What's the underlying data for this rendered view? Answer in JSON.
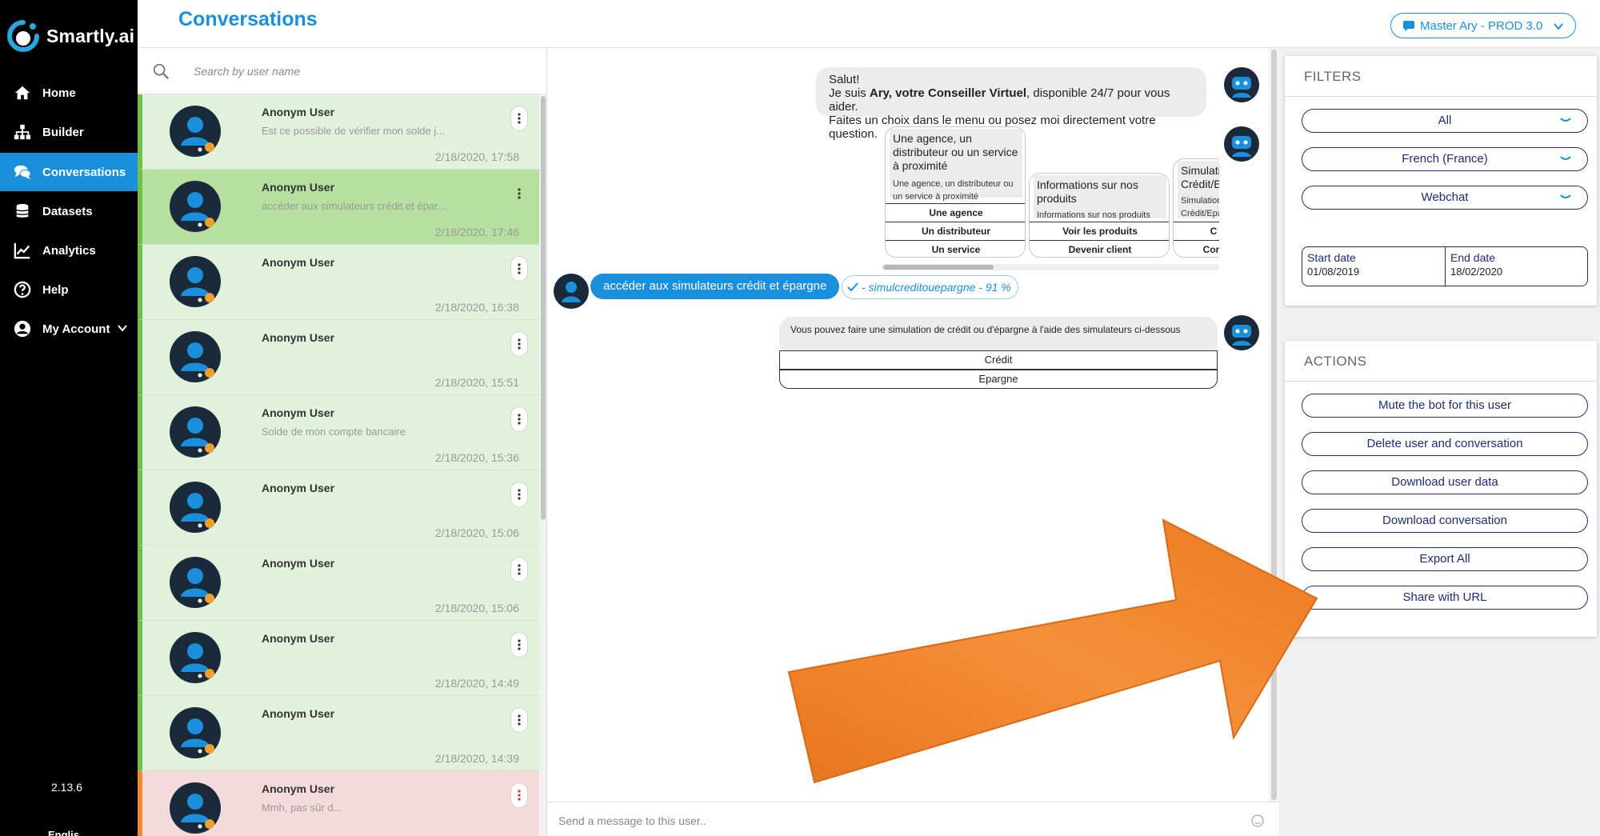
{
  "brand": {
    "name": "Smartly.ai"
  },
  "sidebar": {
    "items": [
      {
        "label": "Home",
        "icon": "home-icon"
      },
      {
        "label": "Builder",
        "icon": "sitemap-icon"
      },
      {
        "label": "Conversations",
        "icon": "chat-icon"
      },
      {
        "label": "Datasets",
        "icon": "database-icon"
      },
      {
        "label": "Analytics",
        "icon": "chart-icon"
      },
      {
        "label": "Help",
        "icon": "help-icon"
      },
      {
        "label": "My Account",
        "icon": "user-icon"
      }
    ],
    "version": "2.13.6"
  },
  "header": {
    "title": "Conversations",
    "bot_selector": "Master Ary - PROD 3.0"
  },
  "search": {
    "placeholder": "Search by user name"
  },
  "conversations": [
    {
      "name": "Anonym User",
      "preview": "Est ce possible de vérifier mon solde j...",
      "time": "2/18/2020, 17:58"
    },
    {
      "name": "Anonym User",
      "preview": "accéder aux simulateurs crédit et épar...",
      "time": "2/18/2020, 17:46"
    },
    {
      "name": "Anonym User",
      "preview": "",
      "time": "2/18/2020, 16:38"
    },
    {
      "name": "Anonym User",
      "preview": "",
      "time": "2/18/2020, 15:51"
    },
    {
      "name": "Anonym User",
      "preview": "Solde de mon compte bancaire",
      "time": "2/18/2020, 15:36"
    },
    {
      "name": "Anonym User",
      "preview": "",
      "time": "2/18/2020, 15:06"
    },
    {
      "name": "Anonym User",
      "preview": "",
      "time": "2/18/2020, 15:06"
    },
    {
      "name": "Anonym User",
      "preview": "",
      "time": "2/18/2020, 14:49"
    },
    {
      "name": "Anonym User",
      "preview": "",
      "time": "2/18/2020, 14:39"
    },
    {
      "name": "Anonym User",
      "preview": "Mmh, pas sûr d...",
      "time": ""
    }
  ],
  "chat": {
    "welcome": {
      "line1": "Salut!",
      "line2_pre": "Je suis ",
      "line2_bold": "Ary, votre Conseiller Virtuel",
      "line2_post": ", disponible 24/7 pour vous aider.",
      "line3": "Faites un choix dans le menu ou posez moi directement votre question."
    },
    "cards": [
      {
        "title": "Une agence, un distributeur ou un service à proximité",
        "subtitle": "Une agence, un distributeur ou un service à proximité",
        "buttons": [
          "Une agence",
          "Un distributeur",
          "Un service"
        ]
      },
      {
        "title": "Informations sur nos produits",
        "subtitle": "Informations sur nos produits",
        "buttons": [
          "Voir les produits",
          "Devenir client"
        ]
      },
      {
        "title": "Simulati Crédit/E",
        "subtitle": "Simulation Crédit/Epa",
        "buttons": [
          "C",
          "Com"
        ]
      }
    ],
    "user_message": "accéder aux simulateurs crédit et épargne",
    "intent": "- simulcreditouepargne - 91 %",
    "bot_reply": "Vous pouvez faire une simulation de crédit ou d'épargne à l'aide des simulateurs ci-dessous",
    "reply_buttons": [
      "Crédit",
      "Epargne"
    ],
    "composer_placeholder": "Send a message to this user.."
  },
  "filters": {
    "title": "FILTERS",
    "selects": [
      "All",
      "French (France)",
      "Webchat"
    ],
    "start_label": "Start date",
    "start_value": "01/08/2019",
    "end_label": "End date",
    "end_value": "18/02/2020"
  },
  "actions": {
    "title": "ACTIONS",
    "buttons": [
      "Mute the bot for this user",
      "Delete user and conversation",
      "Download user data",
      "Download conversation",
      "Export All",
      "Share with URL"
    ]
  },
  "colors": {
    "sidebar_bg": "#000000",
    "accent": "#1a8fdb",
    "navy": "#1e2c7a",
    "row_green": "#e1f1db",
    "row_selected": "#b6e0a0",
    "row_red": "#f4dadb",
    "arrow": "#f0822a"
  }
}
